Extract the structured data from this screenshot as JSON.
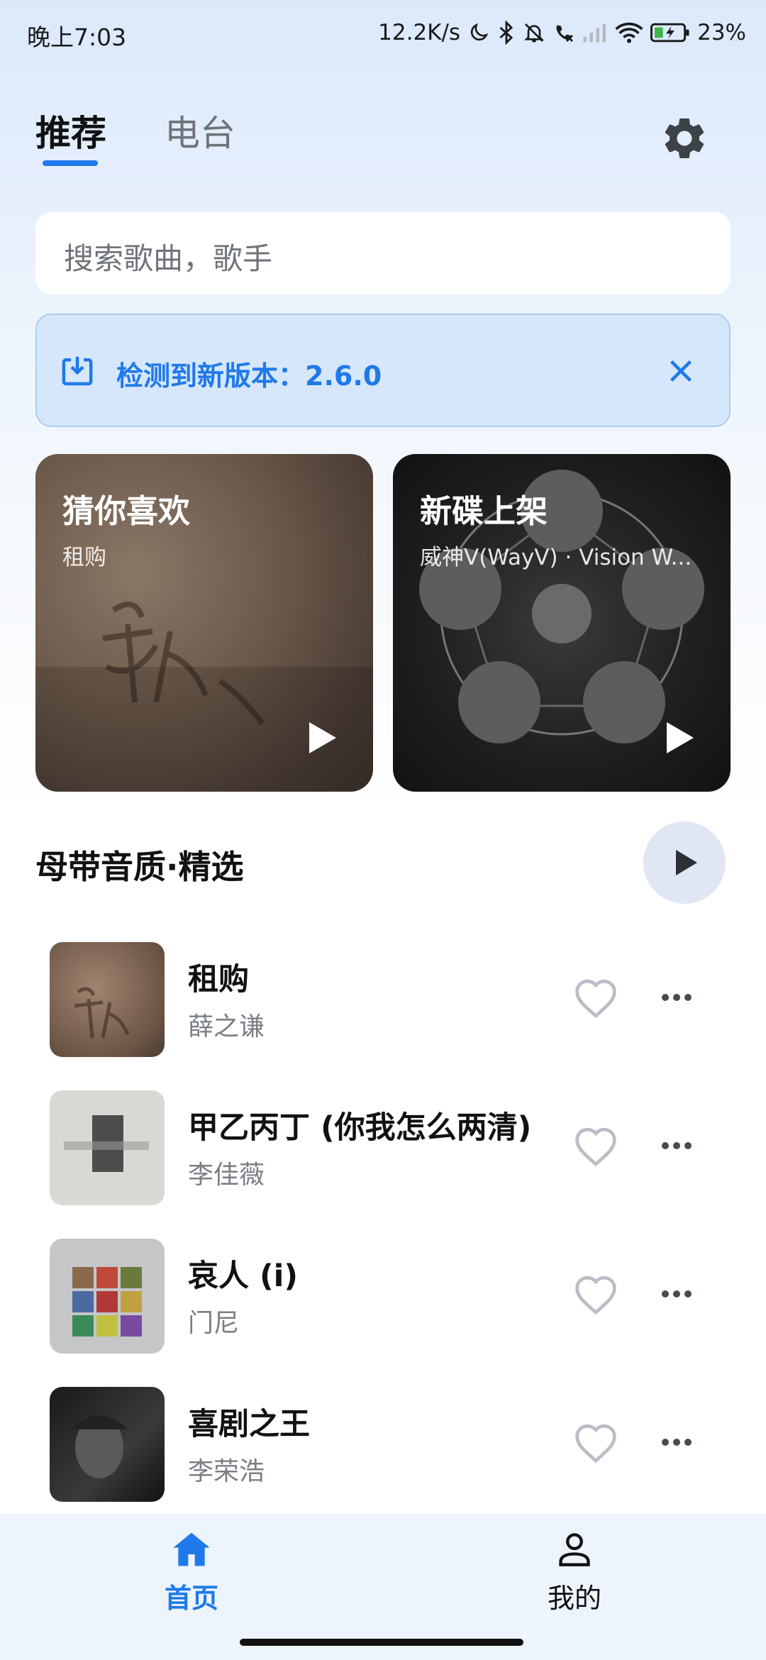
{
  "status_bar": {
    "time": "晚上7:03",
    "net_speed": "12.2K/s",
    "battery": "23%"
  },
  "tabs": [
    {
      "label": "推荐",
      "active": true
    },
    {
      "label": "电台",
      "active": false
    }
  ],
  "search": {
    "placeholder": "搜索歌曲，歌手"
  },
  "update_banner": {
    "text": "检测到新版本：2.6.0"
  },
  "cards": [
    {
      "title": "猜你喜欢",
      "subtitle": "租购"
    },
    {
      "title": "新碟上架",
      "subtitle": "威神V(WayV) · Vision W..."
    }
  ],
  "section": {
    "title": "母带音质·精选"
  },
  "songs": [
    {
      "title": "租购",
      "artist": "薛之谦"
    },
    {
      "title": "甲乙丙丁 (你我怎么两清)",
      "artist": "李佳薇"
    },
    {
      "title": "哀人 (i)",
      "artist": "门尼"
    },
    {
      "title": "喜剧之王",
      "artist": "李荣浩"
    }
  ],
  "bottom_nav": [
    {
      "label": "首页",
      "active": true
    },
    {
      "label": "我的",
      "active": false
    }
  ],
  "colors": {
    "accent": "#1f79ea",
    "banner_bg": "#d6e7fb",
    "secondary_text": "#7a7f85"
  }
}
